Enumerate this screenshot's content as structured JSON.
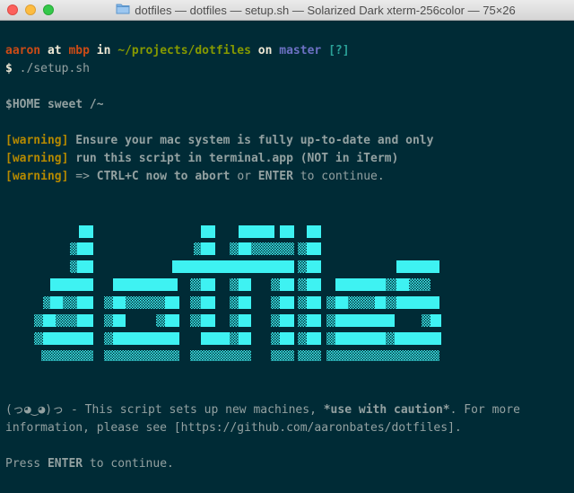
{
  "window": {
    "title": "dotfiles — dotfiles — setup.sh — Solarized Dark xterm-256color — 75×26"
  },
  "prompt": {
    "user": "aaron",
    "at": "at",
    "host": "mbp",
    "in": "in",
    "path": "~/projects/dotfiles",
    "on": "on",
    "branch": "master",
    "status": "[?]",
    "symbol": "$",
    "command": "./setup.sh"
  },
  "banner": "$HOME sweet /~",
  "warnings": [
    {
      "tag": "[warning]",
      "text": "Ensure your mac system is fully up-to-date and only"
    },
    {
      "tag": "[warning]",
      "text": "run this script in terminal.app (NOT in iTerm)"
    }
  ],
  "warning3": {
    "tag": "[warning]",
    "arrow": "=>",
    "keys": "CTRL+C now to abort",
    "or": "or",
    "enter": "ENTER",
    "rest": "to continue."
  },
  "logo_text": "dotfiles",
  "info": {
    "face": "(っ◕‿◕)っ",
    "dash": " - This script sets up new machines, ",
    "caution": "*use with caution*",
    "rest1": ". For more",
    "line2": "information, please see [https://github.com/aaronbates/dotfiles]."
  },
  "press": {
    "pre": "Press ",
    "enter": "ENTER",
    "post": " to continue."
  },
  "colors": {
    "background": "#002b36",
    "logo": "#3ef2f2"
  }
}
